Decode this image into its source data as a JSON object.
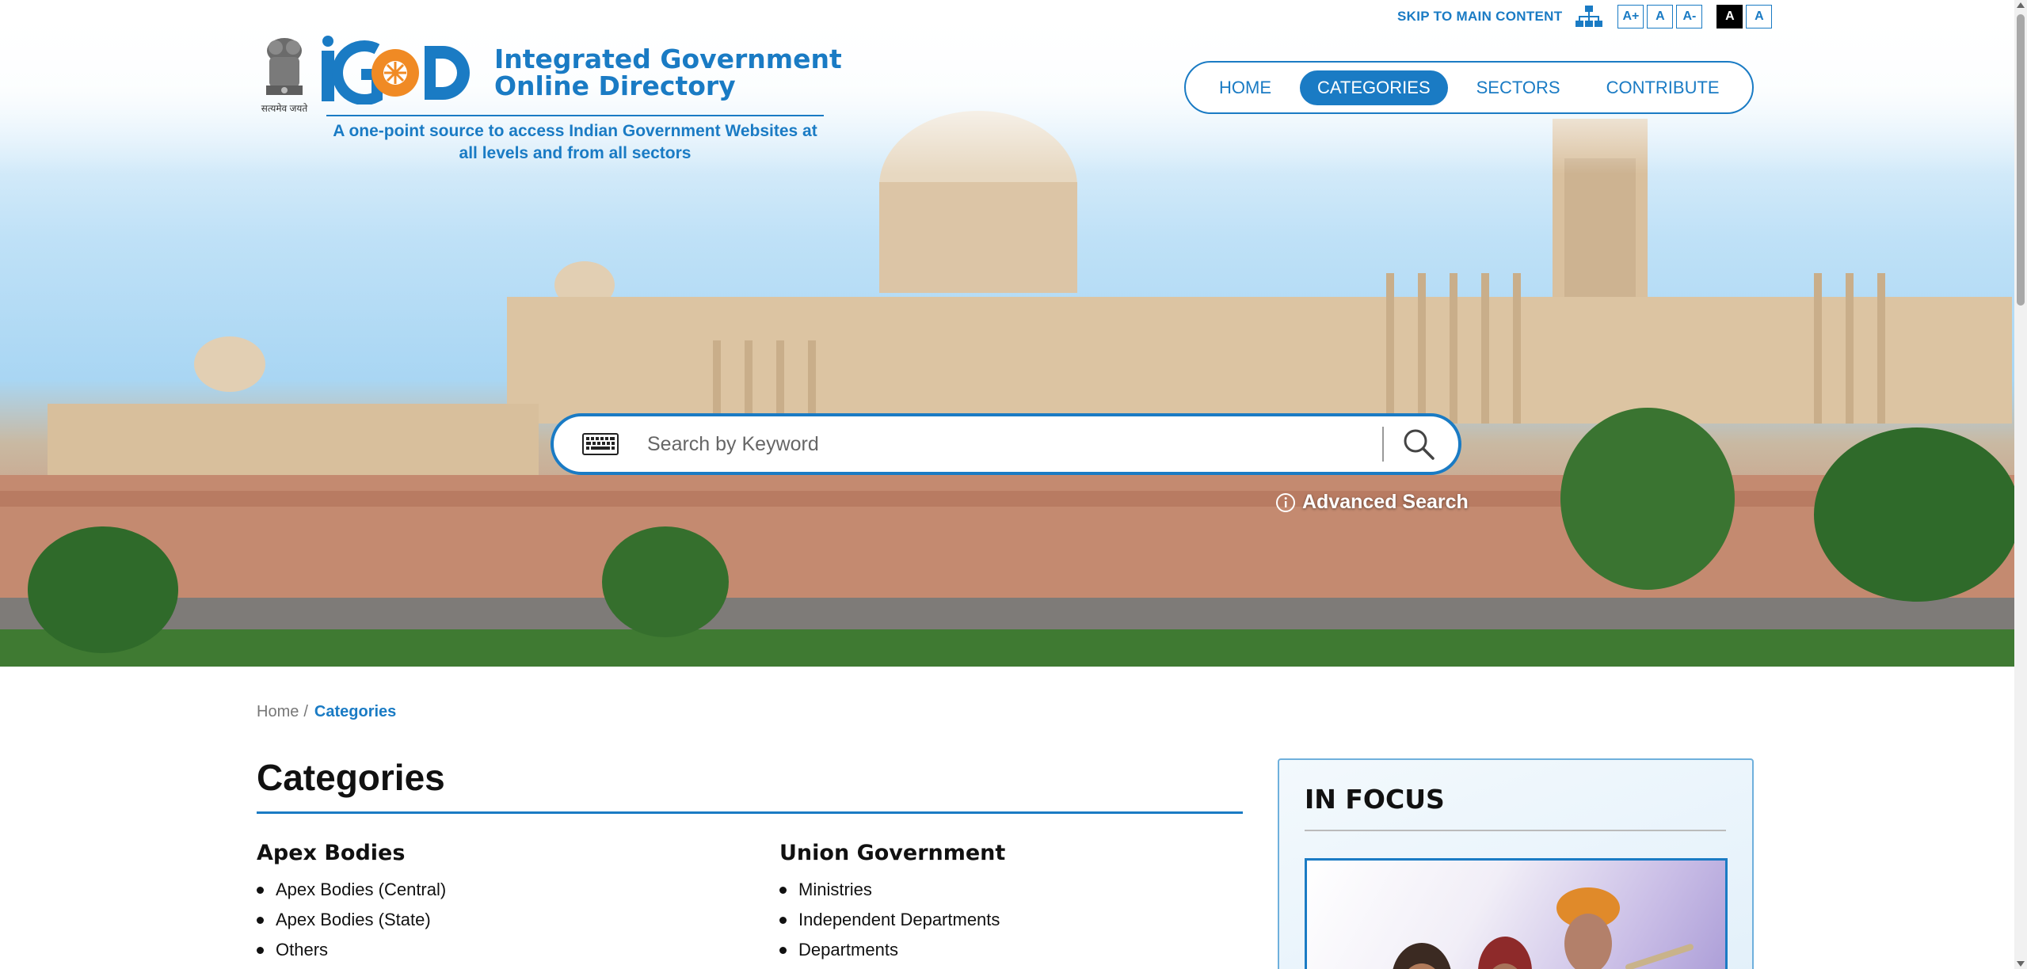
{
  "header": {
    "skip_link": "SKIP TO MAIN CONTENT",
    "font_buttons": [
      "A+",
      "A",
      "A-"
    ],
    "contrast_buttons": [
      "A",
      "A"
    ],
    "emblem_caption": "सत्यमेव जयते",
    "brand_line1": "Integrated Government",
    "brand_line2": "Online Directory",
    "tagline": "A one-point source to access Indian Government Websites at all levels and from all sectors"
  },
  "nav": {
    "items": [
      {
        "label": "HOME",
        "active": false
      },
      {
        "label": "CATEGORIES",
        "active": true
      },
      {
        "label": "SECTORS",
        "active": false
      },
      {
        "label": "CONTRIBUTE",
        "active": false
      }
    ]
  },
  "search": {
    "placeholder": "Search by Keyword",
    "advanced_label": "Advanced Search"
  },
  "breadcrumb": {
    "home": "Home",
    "separator": "/",
    "current": "Categories"
  },
  "main": {
    "title": "Categories",
    "columns": [
      {
        "heading": "Apex Bodies",
        "items": [
          "Apex Bodies (Central)",
          "Apex Bodies (State)",
          "Others"
        ]
      },
      {
        "heading": "Union Government",
        "items": [
          "Ministries",
          "Independent Departments",
          "Departments"
        ]
      }
    ]
  },
  "focus": {
    "title": "IN FOCUS"
  },
  "colors": {
    "accent": "#1a7bc4",
    "logo_orange": "#f08a24"
  }
}
